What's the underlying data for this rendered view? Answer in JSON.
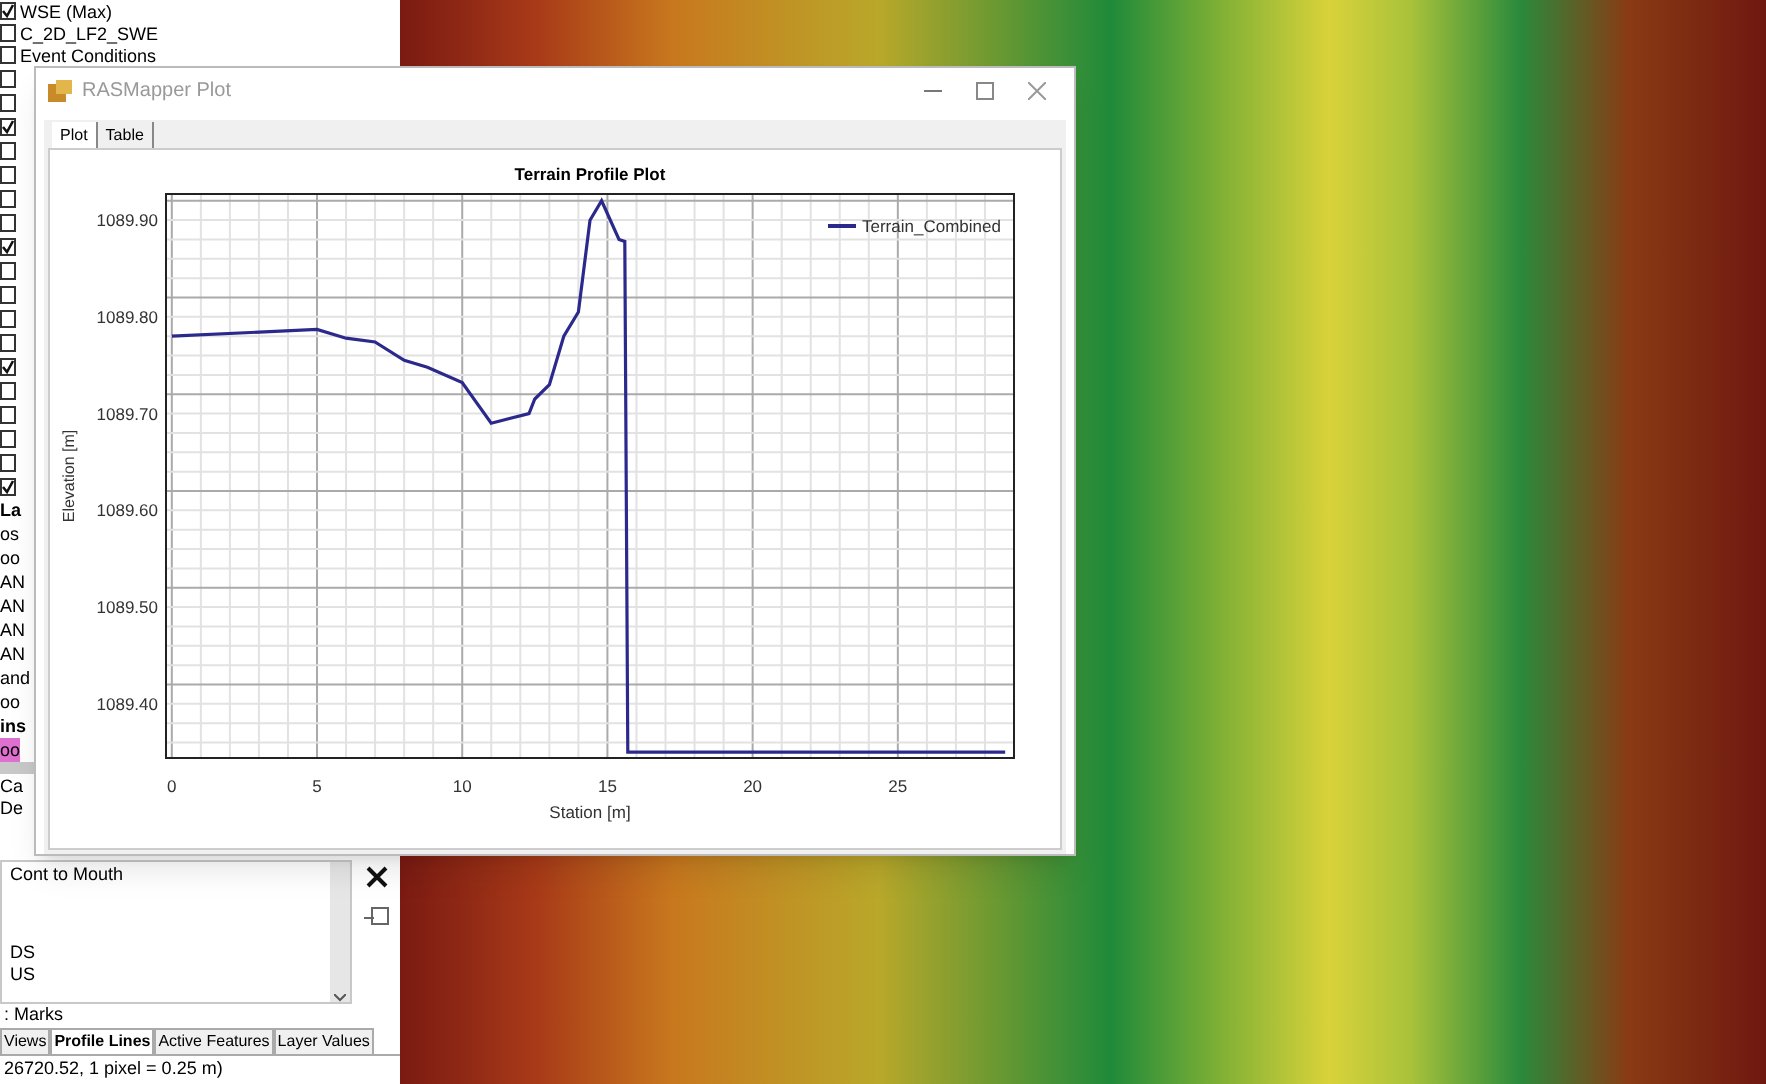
{
  "layers_panel": {
    "rows": [
      {
        "text": "WSE (Max)",
        "checked": true
      },
      {
        "text": "C_2D_LF2_SWE",
        "checked": false
      },
      {
        "text": "Event Conditions",
        "checked": false
      }
    ],
    "covered_rows": [
      {
        "checked": false
      },
      {
        "checked": false
      },
      {
        "checked": true
      },
      {
        "checked": false
      },
      {
        "checked": false
      },
      {
        "checked": false
      },
      {
        "checked": false
      },
      {
        "checked": true
      },
      {
        "checked": false
      },
      {
        "checked": false
      },
      {
        "checked": false
      },
      {
        "checked": false
      },
      {
        "checked": true
      },
      {
        "checked": false
      },
      {
        "checked": false
      },
      {
        "checked": false
      },
      {
        "checked": false
      },
      {
        "checked": true
      }
    ],
    "fragments": [
      {
        "text": "La",
        "bold": true,
        "highlighted": false
      },
      {
        "text": "os",
        "bold": false,
        "highlighted": false
      },
      {
        "text": "oo",
        "bold": false,
        "highlighted": false
      },
      {
        "text": "AN",
        "bold": false,
        "highlighted": false
      },
      {
        "text": "AN",
        "bold": false,
        "highlighted": false
      },
      {
        "text": "AN",
        "bold": false,
        "highlighted": false
      },
      {
        "text": "AN",
        "bold": false,
        "highlighted": false
      },
      {
        "text": "and",
        "bold": false,
        "highlighted": false
      },
      {
        "text": "oo",
        "bold": false,
        "highlighted": false
      },
      {
        "text": "ins",
        "bold": true,
        "highlighted": false
      },
      {
        "text": "oo",
        "bold": false,
        "highlighted": true
      }
    ],
    "lower_fragments": [
      "Ca",
      "De"
    ]
  },
  "profile_list": {
    "items": [
      "Cont to Mouth",
      "DS",
      "US"
    ]
  },
  "marks_label": ": Marks",
  "bottom_tabs": [
    {
      "label": "Views",
      "selected": false
    },
    {
      "label": "Profile Lines",
      "selected": true
    },
    {
      "label": "Active Features",
      "selected": false
    },
    {
      "label": "Layer Values",
      "selected": false
    }
  ],
  "status_bar": "26720.52, 1 pixel = 0.25 m)",
  "plot_window": {
    "title": "RASMapper Plot",
    "tabs": [
      {
        "label": "Plot",
        "selected": true
      },
      {
        "label": "Table",
        "selected": false
      }
    ],
    "chart_data": {
      "type": "line",
      "title": "Terrain Profile Plot",
      "xlabel": "Station [m]",
      "ylabel": "Elevation [m]",
      "x": [
        0,
        5,
        6,
        7,
        8,
        8.8,
        10,
        11,
        12.3,
        12.5,
        13,
        13.5,
        14,
        14.4,
        14.8,
        15.4,
        15.6,
        15.7,
        28.7
      ],
      "series": [
        {
          "name": "Terrain_Combined",
          "color": "#2b2a8c",
          "values": [
            1089.78,
            1089.787,
            1089.778,
            1089.774,
            1089.755,
            1089.748,
            1089.732,
            1089.69,
            1089.7,
            1089.715,
            1089.73,
            1089.78,
            1089.805,
            1089.9,
            1089.92,
            1089.88,
            1089.878,
            1089.35,
            1089.35
          ]
        }
      ],
      "grid": true,
      "xlim": [
        -0.2,
        29
      ],
      "ylim": [
        1089.344,
        1089.927
      ],
      "xticks": [
        0,
        5,
        10,
        15,
        20,
        25
      ],
      "yticks": [
        {
          "value": 1089.4,
          "label": "1089.40"
        },
        {
          "value": 1089.5,
          "label": "1089.50"
        },
        {
          "value": 1089.6,
          "label": "1089.60"
        },
        {
          "value": 1089.7,
          "label": "1089.70"
        },
        {
          "value": 1089.8,
          "label": "1089.80"
        },
        {
          "value": 1089.9,
          "label": "1089.90"
        }
      ]
    }
  }
}
